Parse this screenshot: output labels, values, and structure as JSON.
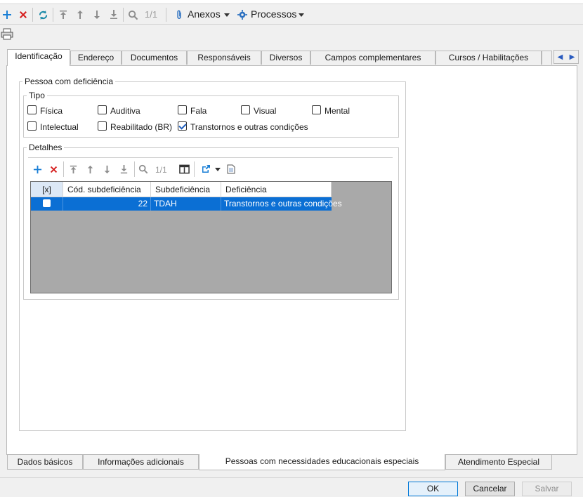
{
  "toolbar": {
    "counter": "1/1",
    "anexos_label": "Anexos",
    "processos_label": "Processos"
  },
  "tabs": [
    {
      "label": "Identificação"
    },
    {
      "label": "Endereço"
    },
    {
      "label": "Documentos"
    },
    {
      "label": "Responsáveis"
    },
    {
      "label": "Diversos"
    },
    {
      "label": "Campos complementares"
    },
    {
      "label": "Cursos / Habilitações"
    }
  ],
  "pessoa": {
    "legend": "Pessoa com deficiência",
    "tipo_legend": "Tipo",
    "tipos": [
      {
        "label": "Física",
        "checked": false
      },
      {
        "label": "Auditiva",
        "checked": false
      },
      {
        "label": "Fala",
        "checked": false
      },
      {
        "label": "Visual",
        "checked": false
      },
      {
        "label": "Mental",
        "checked": false
      },
      {
        "label": "Intelectual",
        "checked": false
      },
      {
        "label": "Reabilitado (BR)",
        "checked": false
      },
      {
        "label": "Transtornos e outras condições",
        "checked": true
      }
    ],
    "detalhes_legend": "Detalhes",
    "detalhes_counter": "1/1"
  },
  "grid": {
    "columns": [
      "[x]",
      "Cód. subdeficiência",
      "Subdeficiência",
      "Deficiência"
    ],
    "rows": [
      {
        "selected": false,
        "codigo": "22",
        "subdeficiencia": "TDAH",
        "deficiencia": "Transtornos e outras condições"
      }
    ]
  },
  "bottom_tabs": [
    {
      "label": "Dados básicos"
    },
    {
      "label": "Informações adicionais"
    },
    {
      "label": "Pessoas com necessidades educacionais especiais"
    },
    {
      "label": "Atendimento Especial"
    }
  ],
  "footer": {
    "ok_label": "OK",
    "cancel_label": "Cancelar",
    "save_label": "Salvar"
  },
  "colors": {
    "selection": "#0b6fd4",
    "add_icon": "#1a7fd6",
    "delete_icon": "#d62020",
    "grid_background": "#a9a9a9"
  }
}
